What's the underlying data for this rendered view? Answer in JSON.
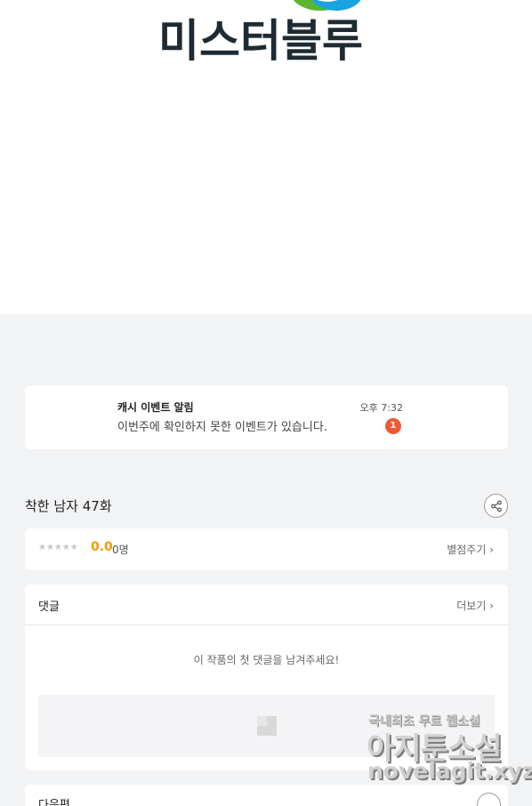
{
  "banner": {
    "logo_text": "미스터블루",
    "logo_colors": {
      "green": "#5cb52f",
      "blue": "#1aa3e0"
    }
  },
  "notification": {
    "title": "캐시 이벤트 알림",
    "message": "이번주에 확인하지 못한 이벤트가 있습니다.",
    "time": "오후 7:32",
    "badge_count": "1",
    "badge_color": "#ee5a37"
  },
  "episode": {
    "title": "착한 남자 47화",
    "share_icon": "share-icon"
  },
  "rating": {
    "stars": "★★★★★",
    "stars_filled": 0,
    "value": "0.0",
    "count": "0명",
    "rate_link": "별점주기 ›"
  },
  "comments": {
    "title": "댓글",
    "more_link": "더보기 ›",
    "empty_message": "이 작품의 첫 댓글을 남겨주세요!"
  },
  "next_episode": {
    "title": "다음편"
  },
  "watermark": {
    "line1": "국내최초 무료 웹소설",
    "line2": "아지툰소설",
    "line3": "novelagit.xyz"
  },
  "colors": {
    "page_bg": "#f2f3f5",
    "accent_rating": "#f29900"
  }
}
